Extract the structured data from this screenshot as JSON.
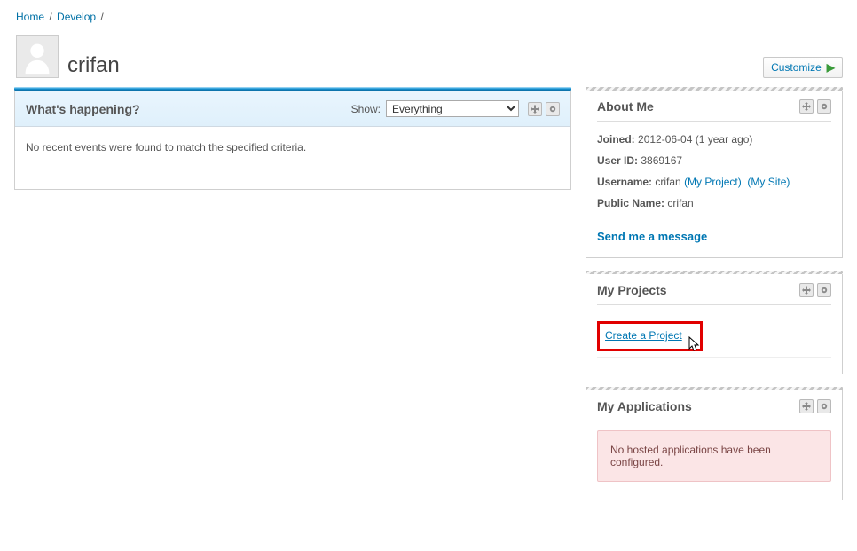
{
  "breadcrumbs": {
    "home_label": "Home",
    "develop_label": "Develop"
  },
  "profile": {
    "display_name": "crifan"
  },
  "customize_label": "Customize",
  "feed": {
    "title": "What's happening?",
    "show_label": "Show:",
    "show_options": [
      "Everything"
    ],
    "show_selected": "Everything",
    "empty_message": "No recent events were found to match the specified criteria."
  },
  "about": {
    "title": "About Me",
    "joined_label": "Joined:",
    "joined_value": "2012-06-04 (1 year ago)",
    "userid_label": "User ID:",
    "userid_value": "3869167",
    "username_label": "Username:",
    "username_value": "crifan",
    "my_project_link": "(My Project)",
    "my_site_link": "(My Site)",
    "publicname_label": "Public Name:",
    "publicname_value": "crifan",
    "send_message_label": "Send me a message"
  },
  "projects": {
    "title": "My Projects",
    "create_link_label": "Create a Project"
  },
  "applications": {
    "title": "My Applications",
    "none_message": "No hosted applications have been configured."
  }
}
